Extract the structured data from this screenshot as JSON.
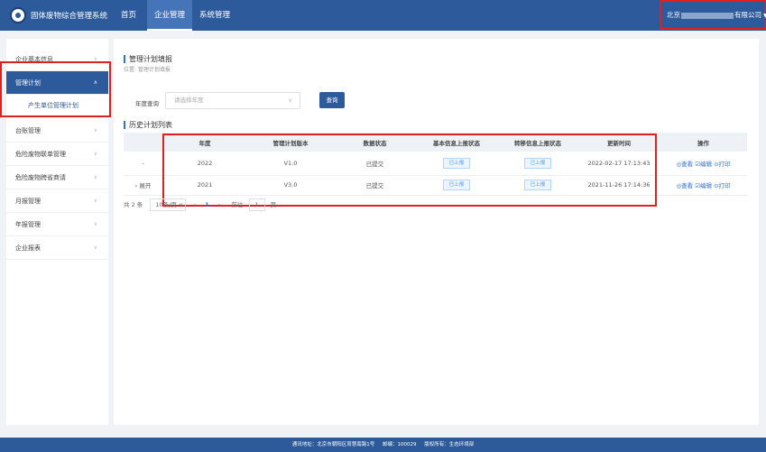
{
  "app": {
    "title": "固体废物综合管理系统"
  },
  "nav": {
    "items": [
      "首页",
      "企业管理",
      "系统管理"
    ],
    "active_index": 1
  },
  "company": {
    "prefix": "北京",
    "suffix": "有限公司"
  },
  "sidebar": {
    "items": [
      {
        "label": "企业基本信息"
      },
      {
        "label": "管理计划",
        "active": true
      },
      {
        "label": "产生单位管理计划",
        "sub": true
      },
      {
        "label": "台账管理"
      },
      {
        "label": "危险废物联单管理"
      },
      {
        "label": "危险废物跨省商请"
      },
      {
        "label": "月报管理"
      },
      {
        "label": "年报管理"
      },
      {
        "label": "企业报表"
      }
    ]
  },
  "page": {
    "title": "管理计划填报",
    "breadcrumb": "位置: 管理计划填报",
    "year_label": "年度查询",
    "year_placeholder": "请选择年度",
    "query_label": "查询",
    "list_title": "历史计划列表"
  },
  "table": {
    "headers": [
      "",
      "年度",
      "管理计划版本",
      "数据状态",
      "基本信息上报状态",
      "转移信息上报状态",
      "更新时间",
      "操作"
    ],
    "rows": [
      {
        "expand": "-",
        "year": "2022",
        "version": "V1.0",
        "status": "已提交",
        "basic": "已上报",
        "transfer": "已上报",
        "updated": "2022-02-17 17:13:43",
        "view": "◎查看",
        "edit": "☑编辑",
        "print": "⊙打印"
      },
      {
        "expand": "› 展开",
        "year": "2021",
        "version": "V3.0",
        "status": "已提交",
        "basic": "已上报",
        "transfer": "已上报",
        "updated": "2021-11-26 17:14:36",
        "view": "◎查看",
        "edit": "☑编辑",
        "print": "⊙打印"
      }
    ]
  },
  "pager": {
    "total": "共 2 条",
    "size": "10条/页",
    "prev": "‹",
    "page": "1",
    "next": "›",
    "goto_label": "前往",
    "goto_value": "1",
    "page_unit": "页"
  },
  "footer": {
    "address": "通讯地址：北京市朝阳区育慧南路1号",
    "postcode": "邮编：100029",
    "copyright": "版权所有：生态环境部"
  }
}
